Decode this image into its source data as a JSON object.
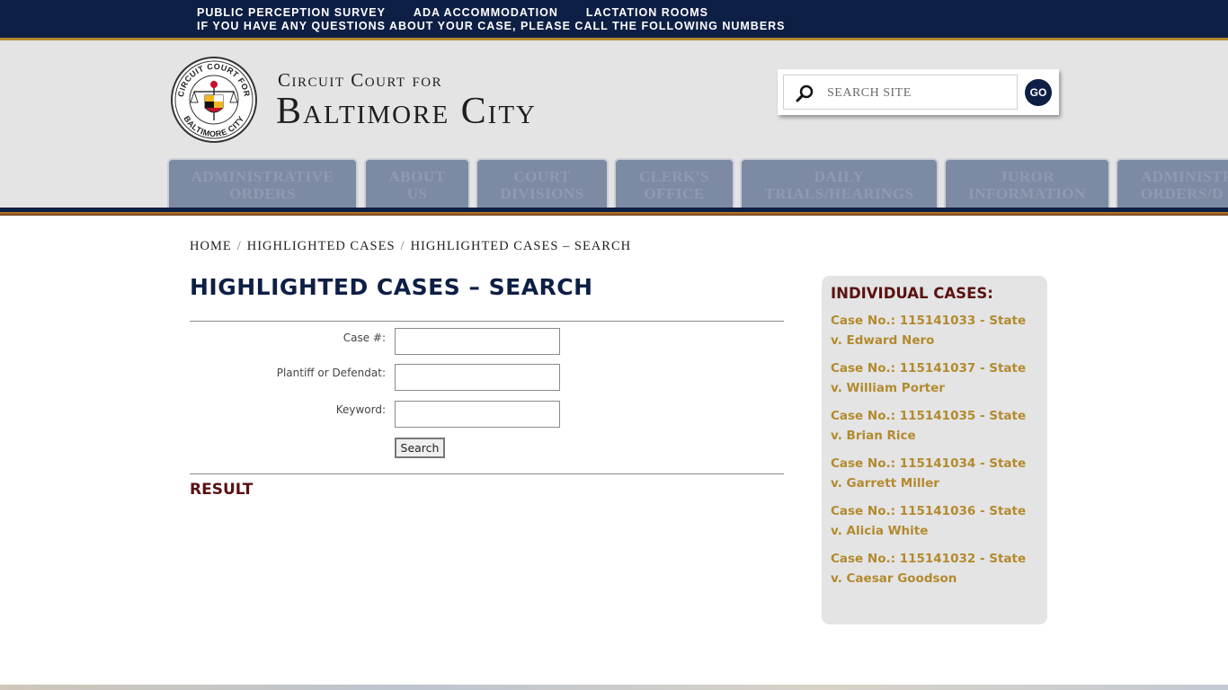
{
  "topbar": {
    "links": [
      "Public Perception Survey",
      "ADA Accommodation",
      "Lactation Rooms"
    ],
    "note": "If you have any questions about your case, please call the following numbers"
  },
  "header": {
    "title_small": "Circuit Court for",
    "title_big": "Baltimore City",
    "seal_text_top": "CIRCUIT COURT FOR",
    "seal_text_bottom": "BALTIMORE CITY"
  },
  "search": {
    "placeholder": "SEARCH SITE",
    "go_label": "GO"
  },
  "nav": {
    "tabs": [
      {
        "label": "Administrative\nOrders"
      },
      {
        "label": "About\nUs"
      },
      {
        "label": "Court\nDivisions"
      },
      {
        "label": "Clerk's\nOffice"
      },
      {
        "label": "Daily\nTrials/Hearings"
      },
      {
        "label": "Juror\nInformation"
      },
      {
        "label": "Administrative\nOrders/D"
      }
    ]
  },
  "breadcrumb": {
    "items": [
      "Home",
      "Highlighted Cases",
      "Highlighted Cases – Search"
    ],
    "separator": "/"
  },
  "main": {
    "title": "Highlighted Cases – Search",
    "form": {
      "case_label": "Case #:",
      "party_label": "Plantiff or Defendat:",
      "keyword_label": "Keyword:",
      "case_value": "",
      "party_value": "",
      "keyword_value": "",
      "search_label": "Search"
    },
    "result_title": "Result"
  },
  "sidebar": {
    "title": "Individual Cases:",
    "cases": [
      "Case No.: 115141033 - State v. Edward Nero",
      "Case No.: 115141037 - State v. William Porter",
      "Case No.: 115141035 - State v. Brian Rice",
      "Case No.: 115141034 - State v. Garrett Miller",
      "Case No.: 115141036 - State v. Alicia White",
      "Case No.: 115141032 - State v. Caesar Goodson"
    ]
  },
  "colors": {
    "navy": "#0e1f45",
    "gold": "#b38a2e",
    "maroon": "#5a1212",
    "tab": "#7d8aa3",
    "header_bg": "#e4e4e4"
  }
}
